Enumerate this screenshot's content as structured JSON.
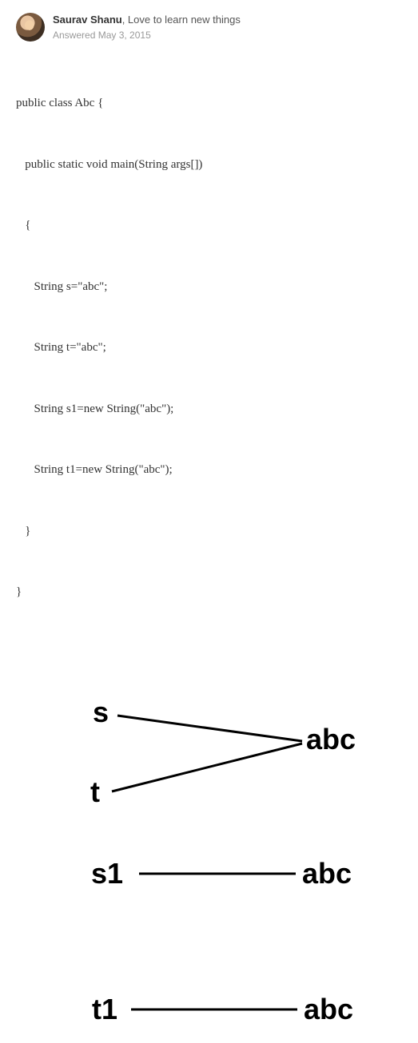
{
  "header": {
    "author": "Saurav Shanu",
    "tagline": ", Love to learn new things",
    "subline": "Answered May 3, 2015"
  },
  "code": {
    "l1": "public class Abc {",
    "l2": "   public static void main(String args[])",
    "l3": "   {",
    "l4": "      String s=\"abc\";",
    "l5": "      String t=\"abc\";",
    "l6": "      String s1=new String(\"abc\");",
    "l7": "      String t1=new String(\"abc\");",
    "l8": "   }",
    "l9": "}"
  },
  "diagram": {
    "s": "s",
    "t": "t",
    "s1": "s1",
    "t1": "t1",
    "abc1": "abc",
    "abc2": "abc",
    "abc3": "abc"
  }
}
